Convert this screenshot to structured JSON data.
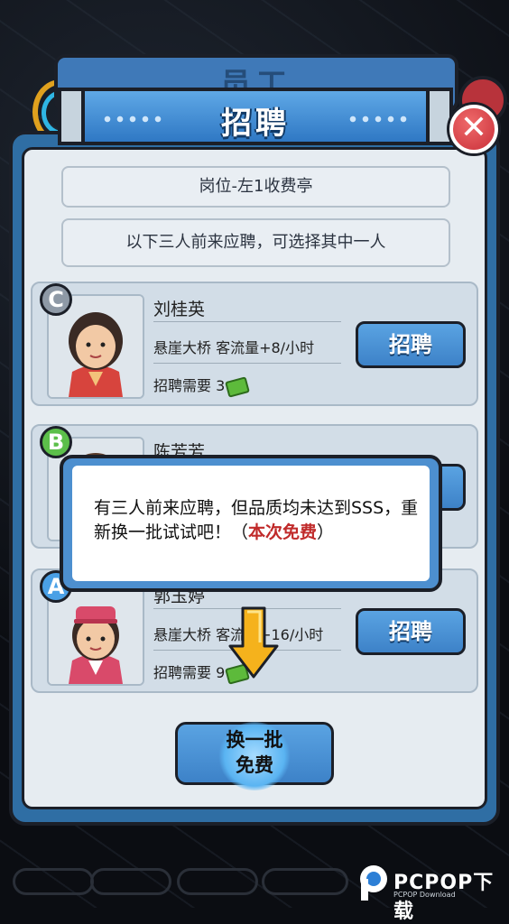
{
  "background_panel": {
    "title": "员工"
  },
  "header": {
    "title": "招聘"
  },
  "position_label": "岗位-左1收费亭",
  "description": "以下三人前来应聘，可选择其中一人",
  "candidates": [
    {
      "grade": "C",
      "grade_color": "#8e99a6",
      "name": "刘桂英",
      "bonus": "悬崖大桥 客流量+8/小时",
      "cost_label": "招聘需要",
      "cost_value": "3",
      "hire_label": "招聘"
    },
    {
      "grade": "B",
      "grade_color": "#5cbf4a",
      "name": "陈芳芳",
      "bonus": "",
      "cost_label": "",
      "cost_value": "",
      "hire_label": ""
    },
    {
      "grade": "A",
      "grade_color": "#4aa0e6",
      "name": "郭玉婷",
      "bonus": "悬崖大桥 客流量+16/小时",
      "cost_label": "招聘需要",
      "cost_value": "9",
      "hire_label": "招聘"
    }
  ],
  "dialog": {
    "text": "有三人前来应聘，但品质均未达到SSS，重新换一批试试吧！（",
    "free_text": "本次免费",
    "close_paren": "）"
  },
  "refresh_button": {
    "line1": "换一批",
    "line2": "免费"
  },
  "watermark": {
    "brand": "PCPOP下载",
    "sub": "PCPOP Download"
  },
  "colors": {
    "accent_blue": "#3d82c8",
    "close_red": "#c9303a",
    "free_red": "#c02a2a"
  }
}
